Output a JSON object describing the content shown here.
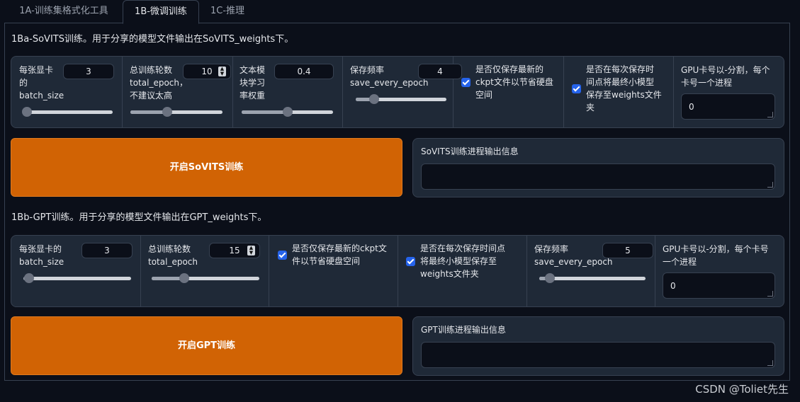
{
  "tabs": [
    "1A-训练集格式化工具",
    "1B-微调训练",
    "1C-推理"
  ],
  "sovits": {
    "title": "1Ba-SoVITS训练。用于分享的模型文件输出在SoVITS_weights下。",
    "batch_size": {
      "label": "每张显卡的batch_size",
      "label_lines": [
        "每张显卡",
        "的",
        "batch_size"
      ],
      "value": "3",
      "slider_fraction": 0.05
    },
    "total_epoch": {
      "label_lines": [
        "总训练轮数",
        "total_epoch，",
        "不建议太高"
      ],
      "value": "10",
      "slider_fraction": 0.4
    },
    "text_lr": {
      "label_lines": [
        "文本模",
        "块学习",
        "率权重"
      ],
      "value": "0.4",
      "slider_fraction": 0.5
    },
    "save_every_epoch": {
      "label_lines": [
        "保存频率",
        "save_every_epoch"
      ],
      "value": "4",
      "slider_fraction": 0.2
    },
    "if_save_latest": {
      "label_lines": [
        "是否仅保存最新的",
        "ckpt文件以节省硬盘",
        "空间"
      ],
      "checked": true
    },
    "if_save_every_weights": {
      "label_lines": [
        "是否在每次保存时",
        "间点将最终小模型",
        "保存至weights文件",
        "夹"
      ],
      "checked": true
    },
    "gpu_numbers": {
      "label_lines": [
        "GPU卡号以-分割，每个",
        "卡号一个进程"
      ],
      "value": "0"
    },
    "start_button": "开启SoVITS训练",
    "output_label": "SoVITS训练进程输出信息",
    "output_value": ""
  },
  "gpt": {
    "title": "1Bb-GPT训练。用于分享的模型文件输出在GPT_weights下。",
    "batch_size": {
      "label_lines": [
        "每张显卡的",
        "batch_size"
      ],
      "value": "3",
      "slider_fraction": 0.05
    },
    "total_epoch": {
      "label_lines": [
        "总训练轮数",
        "total_epoch"
      ],
      "value": "15",
      "slider_fraction": 0.3
    },
    "if_save_latest": {
      "label_lines": [
        "是否仅保存最新的ckpt文",
        "件以节省硬盘空间"
      ],
      "checked": true
    },
    "if_save_every_weights": {
      "label_lines": [
        "是否在每次保存时间点",
        "将最终小模型保存至",
        "weights文件夹"
      ],
      "checked": true
    },
    "save_every_epoch": {
      "label_lines": [
        "保存频率",
        "save_every_epoch"
      ],
      "value": "5",
      "slider_fraction": 0.1
    },
    "gpu_numbers": {
      "label_lines": [
        "GPU卡号以-分割，每个卡号",
        "一个进程"
      ],
      "value": "0"
    },
    "start_button": "开启GPT训练",
    "output_label": "GPT训练进程输出信息",
    "output_value": ""
  },
  "watermark": "CSDN @Toliet先生",
  "colors": {
    "accent": "#d16304",
    "panel": "#1f2937",
    "background": "#0b0f19",
    "checkbox": "#2563eb"
  }
}
